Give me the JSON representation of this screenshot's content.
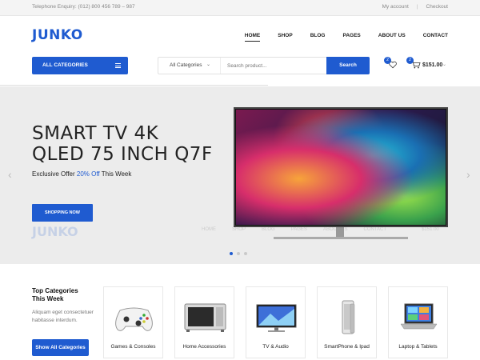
{
  "topbar": {
    "phone": "Telephone Enquiry: (012) 800 456 789 – 987",
    "my_account": "My account",
    "separator": "|",
    "checkout": "Checkout"
  },
  "header": {
    "logo": "JUNKO",
    "nav": [
      {
        "label": "HOME",
        "active": true
      },
      {
        "label": "SHOP",
        "active": false
      },
      {
        "label": "BLOG",
        "active": false
      },
      {
        "label": "PAGES",
        "active": false
      },
      {
        "label": "ABOUT US",
        "active": false
      },
      {
        "label": "CONTACT",
        "active": false
      }
    ]
  },
  "search": {
    "all_categories": "ALL CATEGORIES",
    "category_select": "All Categories",
    "placeholder": "Search product...",
    "button": "Search"
  },
  "cart": {
    "wishlist_count": "2",
    "cart_count": "2",
    "total": "$151.00"
  },
  "hero": {
    "title_line1": "SMART TV 4K",
    "title_line2": "QLED 75 INCH Q7F",
    "offer_prefix": "Exclusive Offer",
    "offer_highlight": "20% Off",
    "offer_suffix": "This Week",
    "button": "SHOPPING NOW",
    "ghost_logo": "JUNKO",
    "ghost_nav": [
      "HOME",
      "SHOP",
      "BLOG",
      "PAGES",
      "ABOUT US",
      "CONTACT"
    ],
    "ghost_total": "$151.00",
    "slides": 3,
    "active_slide": 1
  },
  "categories": {
    "heading_line1": "Top Categories",
    "heading_line2": "This Week",
    "description": "Aliquam eget consectetuer habitasse interdum.",
    "button": "Show All Categories",
    "items": [
      {
        "label": "Games & Consoles"
      },
      {
        "label": "Home Accessories"
      },
      {
        "label": "TV & Audio"
      },
      {
        "label": "SmartPhone & Ipad"
      },
      {
        "label": "Laptop & Tablets"
      }
    ]
  },
  "colors": {
    "brand": "#1f5bd0",
    "text": "#222222",
    "hero_bg": "#ececec"
  }
}
